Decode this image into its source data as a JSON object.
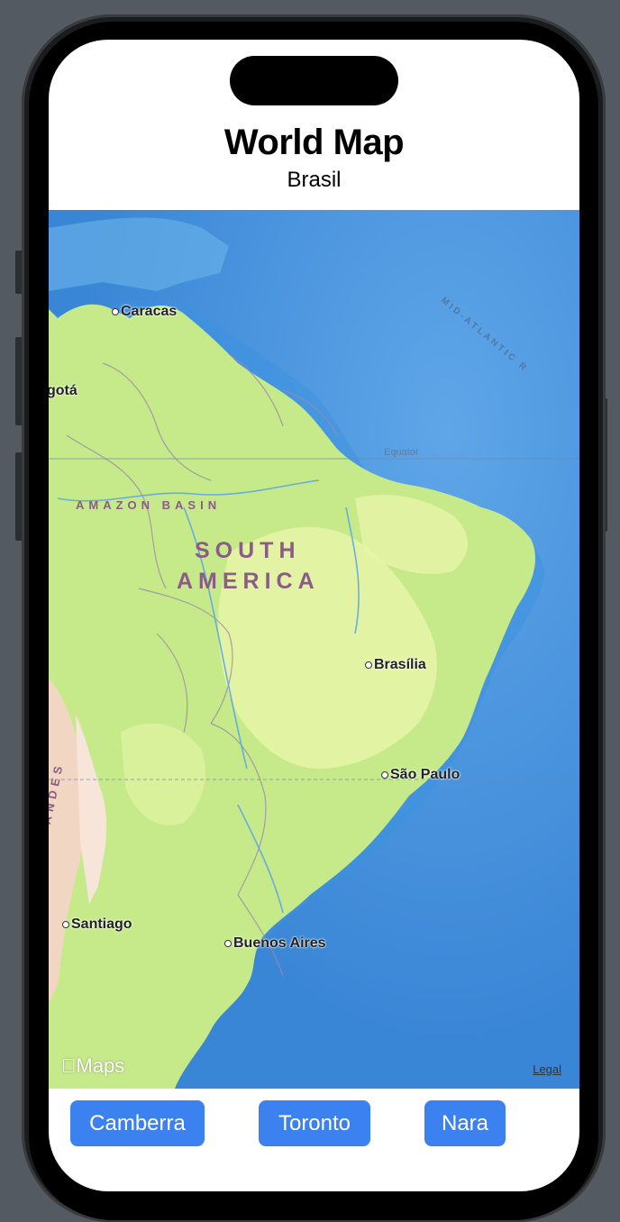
{
  "header": {
    "title": "World Map",
    "subtitle": "Brasil"
  },
  "map": {
    "cities": {
      "caracas": "Caracas",
      "bogota": "gotá",
      "brasilia": "Brasília",
      "sao_paulo": "São Paulo",
      "santiago": "Santiago",
      "buenos_aires": "Buenos Aires"
    },
    "regions": {
      "amazon": "AMAZON BASIN",
      "south": "SOUTH",
      "america": "AMERICA",
      "andes": "ANDES",
      "ridge": "MID-ATLANTIC R"
    },
    "equator": "Equator",
    "logo": "Maps",
    "legal": "Legal"
  },
  "buttons": {
    "camberra": "Camberra",
    "toronto": "Toronto",
    "nara": "Nara"
  },
  "colors": {
    "ocean": "#3f8fdc",
    "land": "#c6ea8a",
    "button": "#3b82f0"
  }
}
